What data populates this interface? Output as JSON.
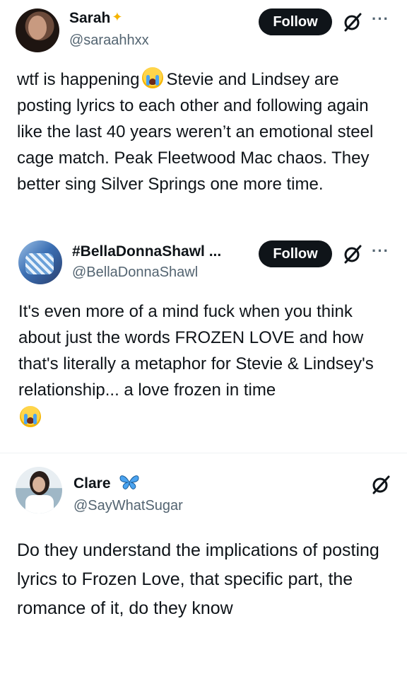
{
  "posts": [
    {
      "name": "Sarah",
      "handle": "@saraahhxx",
      "follow_label": "Follow",
      "more": "···",
      "body": "wtf is happening [emoji] Stevie and Lindsey are posting lyrics to each other and following again like the last 40 years weren’t an emotional steel cage match. Peak Fleetwood Mac chaos. They better sing Silver Springs one more time.",
      "body_before_emoji": "wtf is happening",
      "body_after_emoji": "Stevie and Lindsey are posting lyrics to each other and following again like the last 40 years weren’t an emotional steel cage match. Peak Fleetwood Mac chaos. They better sing Silver Springs one more time."
    },
    {
      "name": "#BellaDonnaShawl ...",
      "handle": "@BellaDonnaShawl",
      "follow_label": "Follow",
      "more": "···",
      "body": "It's even more of a mind fuck when you think about just the words FROZEN LOVE and how that's literally a metaphor for Stevie & Lindsey's relationship... a love frozen in time"
    },
    {
      "name": "Clare",
      "handle": "@SayWhatSugar",
      "body": "Do they understand the implications of posting lyrics to Frozen Love, that specific part, the romance of it, do they know"
    }
  ],
  "icons": {
    "grok": "grok-icon",
    "more": "more-icon",
    "emoji": "loudly-crying-face-emoji",
    "name_badge_1": "sparkle-star-emoji",
    "name_badge_3": "butterfly-emoji"
  },
  "colors": {
    "follow_bg": "#0f1419",
    "handle": "#536471",
    "text": "#0f1419"
  }
}
